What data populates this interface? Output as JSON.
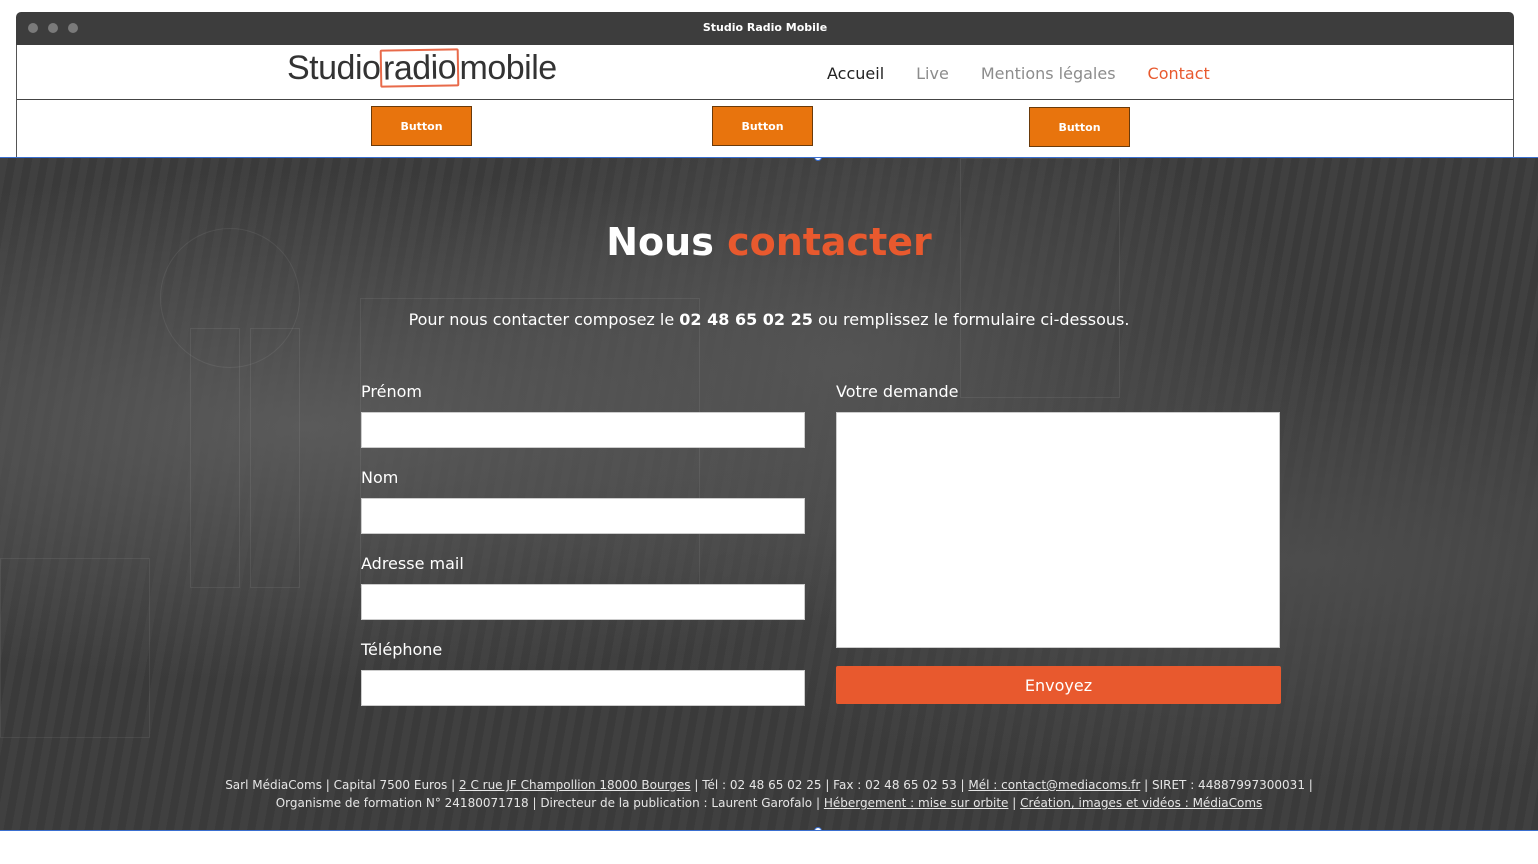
{
  "window": {
    "title": "Studio Radio Mobile"
  },
  "logo": {
    "part1": "Studio",
    "part2": "radio",
    "part3": "mobile"
  },
  "nav": {
    "items": [
      {
        "label": "Accueil"
      },
      {
        "label": "Live"
      },
      {
        "label": "Mentions légales"
      },
      {
        "label": "Contact"
      }
    ]
  },
  "buttons": [
    {
      "label": "Button"
    },
    {
      "label": "Button"
    },
    {
      "label": "Button"
    }
  ],
  "hero": {
    "title_part1": "Nous",
    "title_part2": "contacter",
    "intro_before": "Pour nous contacter composez le",
    "intro_phone": "02 48 65 02 25",
    "intro_after": "ou remplissez le formulaire ci-dessous."
  },
  "form": {
    "firstname_label": "Prénom",
    "lastname_label": "Nom",
    "email_label": "Adresse mail",
    "phone_label": "Téléphone",
    "request_label": "Votre demande",
    "submit_label": "Envoyez"
  },
  "footer": {
    "company": "Sarl MédiaComs | Capital 7500 Euros |",
    "address": "2 C rue JF Champollion 18000 Bourges",
    "phones": "| Tél : 02 48 65 02 25 | Fax : 02 48 65 02 53 |",
    "email": "Mél : contact@mediacoms.fr",
    "siret": "| SIRET : 44887997300031 |",
    "training": "Organisme de formation N° 24180071718 | Directeur de la publication : Laurent Garofalo |",
    "hosting": "Hébergement : mise sur orbite",
    "sep": "|",
    "creation": "Création, images et vidéos : MédiaComs"
  },
  "colors": {
    "accent": "#e8592e",
    "button": "#e8740d",
    "dark": "#3d3d3d"
  }
}
